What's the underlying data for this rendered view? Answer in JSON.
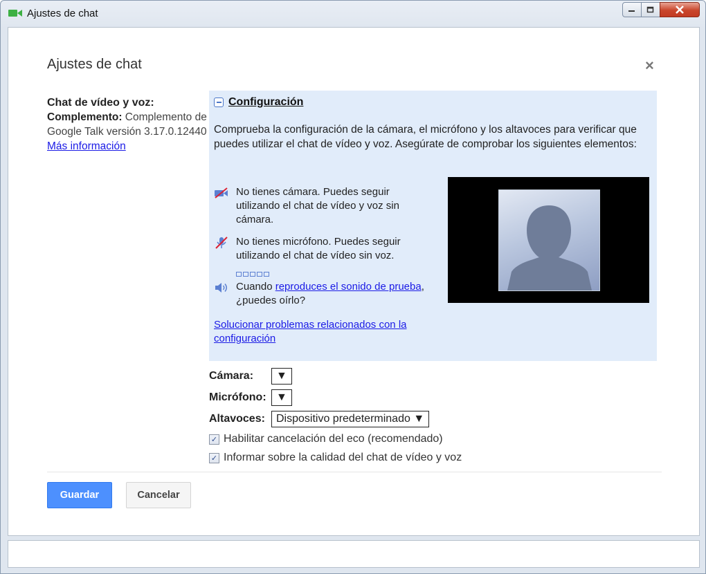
{
  "window": {
    "title": "Ajustes de chat",
    "icon": "green-video-camera-icon"
  },
  "dialog": {
    "title": "Ajustes de chat",
    "close_glyph": "×"
  },
  "left": {
    "heading": "Chat de vídeo y voz:",
    "plugin_label": "Complemento:",
    "plugin_value": " Complemento de Google Talk versión 3.17.0.12440",
    "more_info": "Más información"
  },
  "config": {
    "header": "Configuración",
    "description": "Comprueba la configuración de la cámara, el micrófono y los altavoces para verificar que puedes utilizar el chat de vídeo y voz. Asegúrate de comprobar los siguientes elementos:",
    "camera_msg": "No tienes cámara. Puedes seguir utilizando el chat de vídeo y voz sin cámara.",
    "mic_msg": "No tienes micrófono. Puedes seguir utilizando el chat de vídeo sin voz.",
    "speaker_prefix": "Cuando ",
    "speaker_link": "reproduces el sonido de prueba",
    "speaker_suffix": ", ¿puedes oírlo?",
    "troubleshoot_link": "Solucionar problemas relacionados con la configuración"
  },
  "settings": {
    "camera_label": "Cámara:",
    "camera_value": "",
    "mic_label": "Micrófono:",
    "mic_value": "",
    "speakers_label": "Altavoces:",
    "speakers_value": "Dispositivo predeterminado",
    "arrow": "▼",
    "echo_label": "Habilitar cancelación del eco (recomendado)",
    "echo_checked": true,
    "report_label": "Informar sobre la calidad del chat de vídeo y voz",
    "report_checked": true
  },
  "buttons": {
    "save": "Guardar",
    "cancel": "Cancelar"
  }
}
